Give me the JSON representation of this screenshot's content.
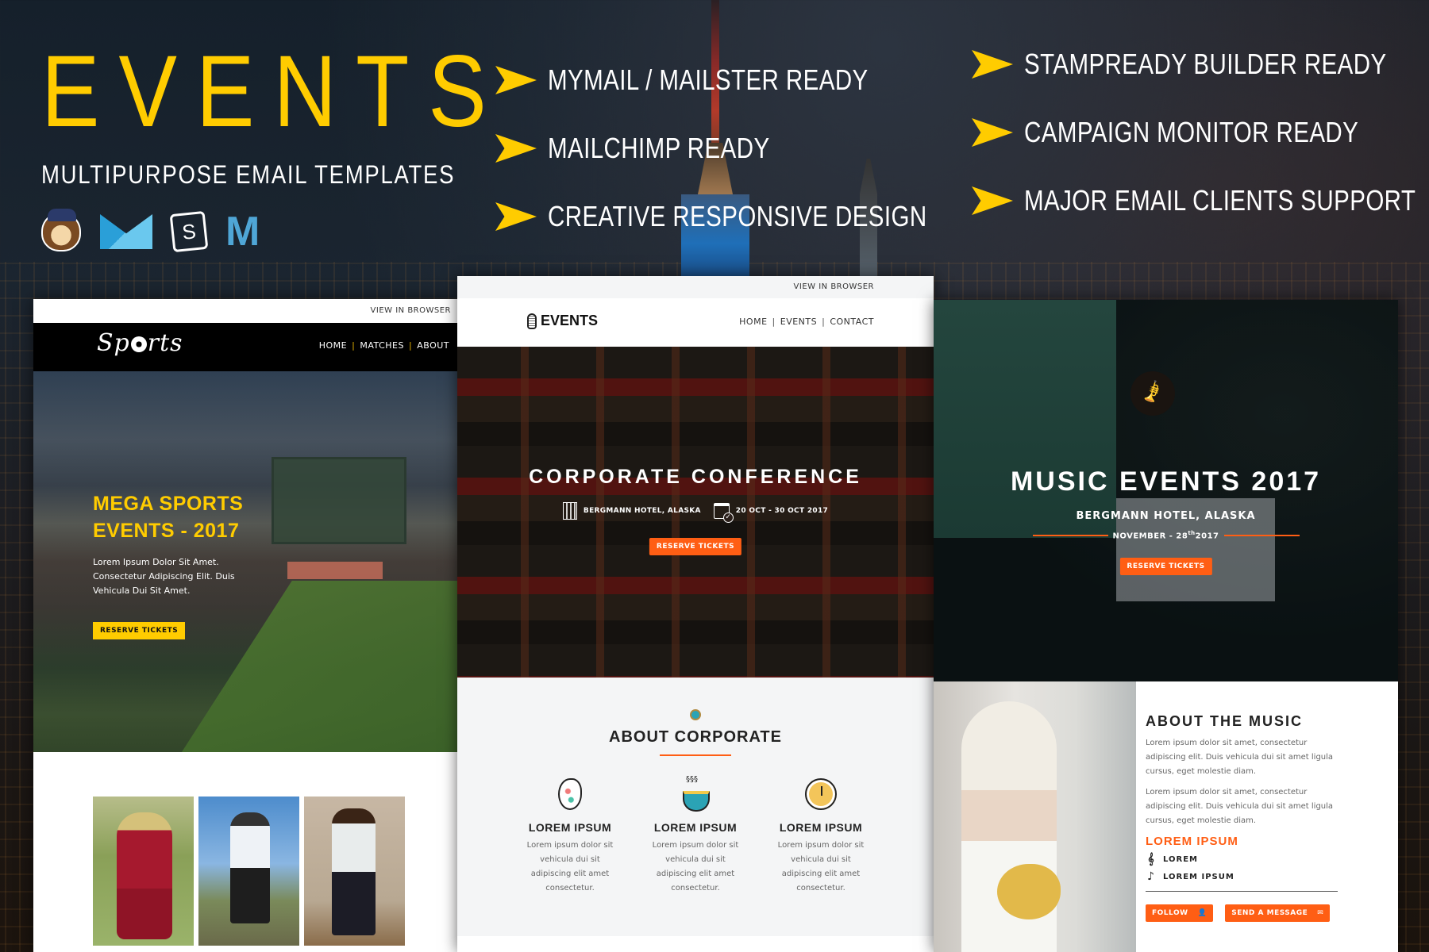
{
  "header": {
    "title": "EVENTS",
    "subtitle": "MULTIPURPOSE EMAIL TEMPLATES",
    "platform_icons": [
      "mailchimp-icon",
      "mailster-icon",
      "stampready-icon",
      "campaign-monitor-icon"
    ],
    "stampready_glyph": "S",
    "campaign_monitor_glyph": "M"
  },
  "features": {
    "col1": [
      "MYMAIL / MAILSTER READY",
      "MAILCHIMP READY",
      "CREATIVE RESPONSIVE DESIGN"
    ],
    "col2": [
      "STAMPREADY BUILDER READY",
      "CAMPAIGN MONITOR READY",
      "MAJOR EMAIL CLIENTS SUPPORT"
    ]
  },
  "colors": {
    "accent_yellow": "#ffcc00",
    "accent_orange": "#ff5e14",
    "background": "#1b2530"
  },
  "sports": {
    "view_in_browser": "VIEW IN BROWSER",
    "logo_prefix": "Sp",
    "logo_suffix": "rts",
    "nav": [
      "HOME",
      "MATCHES",
      "ABOUT"
    ],
    "nav_separator": "|",
    "hero_title": "MEGA SPORTS\nEVENTS - 2017",
    "hero_text": "Lorem Ipsum Dolor Sit Amet. Consectetur Adipiscing Elit. Duis Vehicula Dui Sit Amet.",
    "hero_button": "RESERVE TICKETS",
    "gallery": [
      "football-player-photo",
      "cyclist-photo",
      "basketball-player-photo"
    ]
  },
  "corporate": {
    "view_in_browser": "VIEW IN BROWSER",
    "logo": "EVENTS",
    "nav": [
      "HOME",
      "EVENTS",
      "CONTACT"
    ],
    "nav_separator": "|",
    "hero_title": "CORPORATE CONFERENCE",
    "location": "BERGMANN HOTEL, ALASKA",
    "dates": "20 OCT - 30 OCT 2017",
    "hero_button": "RESERVE TICKETS",
    "about_title": "ABOUT CORPORATE",
    "features": [
      {
        "icon": "palette-icon",
        "title": "LOREM IPSUM",
        "text": "Lorem ipsum dolor sit vehicula dui sit adipiscing elit amet consectetur."
      },
      {
        "icon": "coffee-cup-icon",
        "title": "LOREM IPSUM",
        "text": "Lorem ipsum dolor sit vehicula dui sit adipiscing elit amet consectetur."
      },
      {
        "icon": "clock-icon",
        "title": "LOREM IPSUM",
        "text": "Lorem ipsum dolor sit vehicula dui sit adipiscing elit amet consectetur."
      }
    ]
  },
  "music": {
    "hero_title": "MUSIC EVENTS 2017",
    "location": "BERGMANN HOTEL, ALASKA",
    "date_prefix": "NOVEMBER - 28",
    "date_sup": "th",
    "date_suffix": "2017",
    "hero_button": "RESERVE TICKETS",
    "badge_glyph": "🎺",
    "about_title": "ABOUT THE MUSIC",
    "paragraphs": [
      "Lorem ipsum dolor sit amet, consectetur adipiscing elit. Duis vehicula dui sit amet ligula cursus, eget molestie diam.",
      "Lorem ipsum dolor sit amet, consectetur adipiscing elit. Duis vehicula dui sit amet ligula cursus, eget molestie diam."
    ],
    "subheading": "LOREM IPSUM",
    "list": [
      {
        "icon": "treble-clef-icon",
        "glyph": "𝄞",
        "label": "LOREM"
      },
      {
        "icon": "music-note-icon",
        "glyph": "♪",
        "label": "LOREM IPSUM"
      }
    ],
    "buttons": [
      {
        "label": "FOLLOW",
        "icon": "add-user-icon",
        "glyph": "👤"
      },
      {
        "label": "SEND A MESSAGE",
        "icon": "envelope-icon",
        "glyph": "✉"
      }
    ]
  }
}
